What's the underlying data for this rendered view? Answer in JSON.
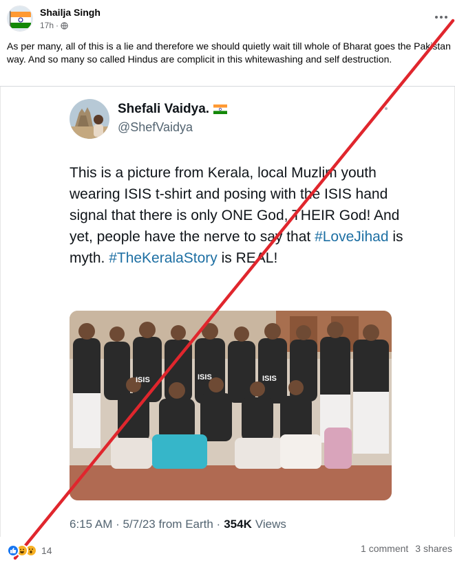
{
  "post": {
    "author": "Shailja Singh",
    "time": "17h",
    "dot": "·",
    "caption": "As per many, all of this is a lie and therefore we should quietly wait till whole of Bharat goes the Pakistan way. And so many so called Hindus are complicit in this whitewashing and self destruction."
  },
  "tweet": {
    "name": "Shefali Vaidya.",
    "handle": "@ShefVaidya",
    "text_1": "This is a picture from Kerala, local Muzlim youth wearing ISIS t-shirt and posing with the ISIS hand signal that there is only ONE God, THEIR God! And yet, people have the nerve to say that ",
    "hashtag_1": "#LoveJihad",
    "text_2": " is myth. ",
    "hashtag_2": "#TheKeralaStory",
    "text_3": " is REAL!",
    "photo_shirt_text": "ISIS",
    "footer_time": "6:15 AM · 5/7/23 from Earth ·",
    "footer_views_count": "354K",
    "footer_views_label": "Views"
  },
  "stats": {
    "reaction_count": "14",
    "comments": "1 comment",
    "shares": "3 shares"
  },
  "icons": {
    "avatar": "indian-flag-avatar",
    "privacy": "globe-icon",
    "more": "more-options-icon",
    "like": "like-reaction-icon",
    "haha": "haha-reaction-icon",
    "wow": "wow-reaction-icon"
  },
  "colors": {
    "slash": "#e0262d",
    "hashtag": "#1d6fa3",
    "like_blue": "#1877f2",
    "meta_gray": "#65676b"
  }
}
